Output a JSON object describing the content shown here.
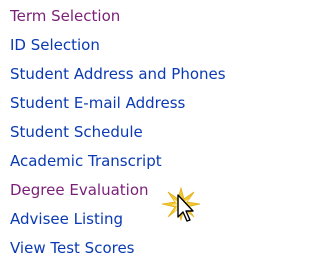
{
  "menu": {
    "items": [
      {
        "label": "Term Selection",
        "state": "visited"
      },
      {
        "label": "ID Selection",
        "state": "unvisited"
      },
      {
        "label": "Student Address and Phones",
        "state": "unvisited"
      },
      {
        "label": "Student E-mail Address",
        "state": "unvisited"
      },
      {
        "label": "Student Schedule",
        "state": "unvisited"
      },
      {
        "label": "Academic Transcript",
        "state": "unvisited"
      },
      {
        "label": "Degree Evaluation",
        "state": "visited"
      },
      {
        "label": "Advisee Listing",
        "state": "unvisited"
      },
      {
        "label": "View Test Scores",
        "state": "unvisited"
      }
    ]
  },
  "colors": {
    "visited_link": "#7a1f78",
    "unvisited_link": "#0a3ab3",
    "click_burst": "#f2c21b"
  },
  "icons": {
    "cursor": "arrow-cursor-icon",
    "click_effect": "click-burst-icon"
  }
}
